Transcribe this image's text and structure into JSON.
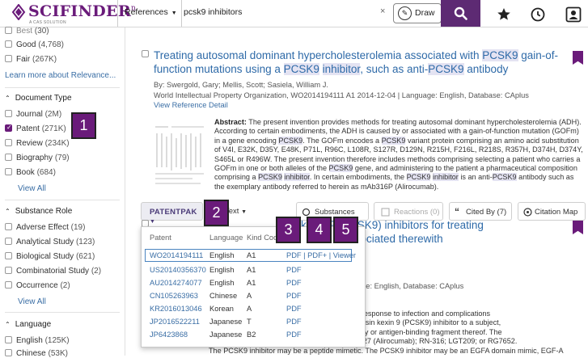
{
  "header": {
    "brand": "SCIFINDER",
    "brand_sup": "n",
    "sub": "A CAS SOLUTION",
    "scope": "References",
    "query": "pcsk9 inhibitors",
    "clear": "×",
    "draw_label": "Draw"
  },
  "sidebar": {
    "top_items": [
      {
        "label": "Best",
        "count": "(30)"
      },
      {
        "label": "Good",
        "count": "(4,768)"
      },
      {
        "label": "Fair",
        "count": "(267K)"
      }
    ],
    "relevance_link": "Learn more about Relevance...",
    "doc_type_title": "Document Type",
    "doc_types": [
      {
        "label": "Journal",
        "count": "(2M)"
      },
      {
        "label": "Patent",
        "count": "(271K)"
      },
      {
        "label": "Review",
        "count": "(234K)"
      },
      {
        "label": "Biography",
        "count": "(79)"
      },
      {
        "label": "Book",
        "count": "(684)"
      }
    ],
    "view_all_1": "View All",
    "substance_role_title": "Substance Role",
    "roles": [
      {
        "label": "Adverse Effect",
        "count": "(19)"
      },
      {
        "label": "Analytical Study",
        "count": "(123)"
      },
      {
        "label": "Biological Study",
        "count": "(621)"
      },
      {
        "label": "Combinatorial Study",
        "count": "(2)"
      },
      {
        "label": "Occurrence",
        "count": "(2)"
      }
    ],
    "view_all_2": "View All",
    "language_title": "Language",
    "languages": [
      {
        "label": "English",
        "count": "(125K)"
      },
      {
        "label": "Chinese",
        "count": "(53K)"
      }
    ]
  },
  "result1": {
    "title_parts": [
      "Treating autosomal dominant hypercholesterolemia associated with ",
      "PCSK9",
      " gain-of-function mutations using a ",
      "PCSK9",
      " ",
      "inhibitor",
      ", such as anti-",
      "PCSK9",
      " antibody"
    ],
    "authors": "By: Swergold, Gary; Mellis, Scott; Sasiela, William J.",
    "source": "World Intellectual Property Organization, WO2014194111 A1 2014-12-04 | Language: English, Database: CAplus",
    "view_detail": "View Reference Detail",
    "abstract_label": "Abstract:",
    "abstract": "The present invention provides methods for treating autosomal dominant hypercholesterolemia (ADH). According to certain embodiments, the ADH is caused by or associated with a gain-of-function mutation (GOFm) in a gene encoding PCSK9. The GOFm encodes a PCSK9 variant protein comprising an amino acid substitution of V4I, E32K, D35Y, E48K, P71L, R96C, L108R, S127R, D129N, R215H, F216L, R218S, R357H, D374H, D374Y, S465L or R496W. The present invention therefore includes methods comprising selecting a patient who carries a GOFm in one or both alleles of the PCSK9 gene, and administering to the patient a pharmaceutical composition comprising a PCSK9 inhibitor. In certain embodiments, the PCSK9 inhibitor is an anti-PCSK9 antibody such as the exemplary antibody referred to herein as mAb316P (Alirocumab).",
    "patentpak_label": "PATENTPAK",
    "full_text_label": "Text",
    "substances_label": "Substances (22)",
    "reactions_label": "Reactions (0)",
    "cited_by_label": "Cited By (7)",
    "citation_map_label": "Citation Map"
  },
  "result2": {
    "title_line1": "kexin 9 (PCSK9) inhibitors for treating",
    "title_line2": "lications associated therewith",
    "meta": "13-11-21 | Language: English, Database: CAplus",
    "abstract_lines": [
      "g an inflammatory response to infection and complications",
      "in convertase subtilisin kexin 9 (PCSK9) inhibitor to a subject,",
      "monoclonal antibody or antigen-binding fragment thereof. The",
      "AR236553/REGN727 (Alirocumab); RN-316; LGT209; or RG7652.",
      "The PCSK9 inhibitor may be a peptide mimetic. The PCSK9 inhibitor may be an EGFA domain mimic, EGF-A"
    ]
  },
  "patentpak_popup": {
    "headers": [
      "Patent",
      "Language",
      "Kind Cod"
    ],
    "rows": [
      {
        "patent": "WO2014194111",
        "language": "English",
        "kind": "A1",
        "links": "PDF |  PDF+ |  Viewer"
      },
      {
        "patent": "US20140356370",
        "language": "English",
        "kind": "A1",
        "links": "PDF"
      },
      {
        "patent": "AU2014274077",
        "language": "English",
        "kind": "A1",
        "links": "PDF"
      },
      {
        "patent": "CN105263963",
        "language": "Chinese",
        "kind": "A",
        "links": "PDF"
      },
      {
        "patent": "KR2016013046",
        "language": "Korean",
        "kind": "A",
        "links": "PDF"
      },
      {
        "patent": "JP2016522211",
        "language": "Japanese",
        "kind": "T",
        "links": "PDF"
      },
      {
        "patent": "JP6423868",
        "language": "Japanese",
        "kind": "B2",
        "links": "PDF"
      }
    ]
  },
  "callouts": [
    "1",
    "2",
    "3",
    "4",
    "5"
  ],
  "colors": {
    "brand": "#6a1b7a",
    "search_button": "#5d2a73",
    "link": "#2e6aa8",
    "highlight": "#e4e3f2"
  }
}
